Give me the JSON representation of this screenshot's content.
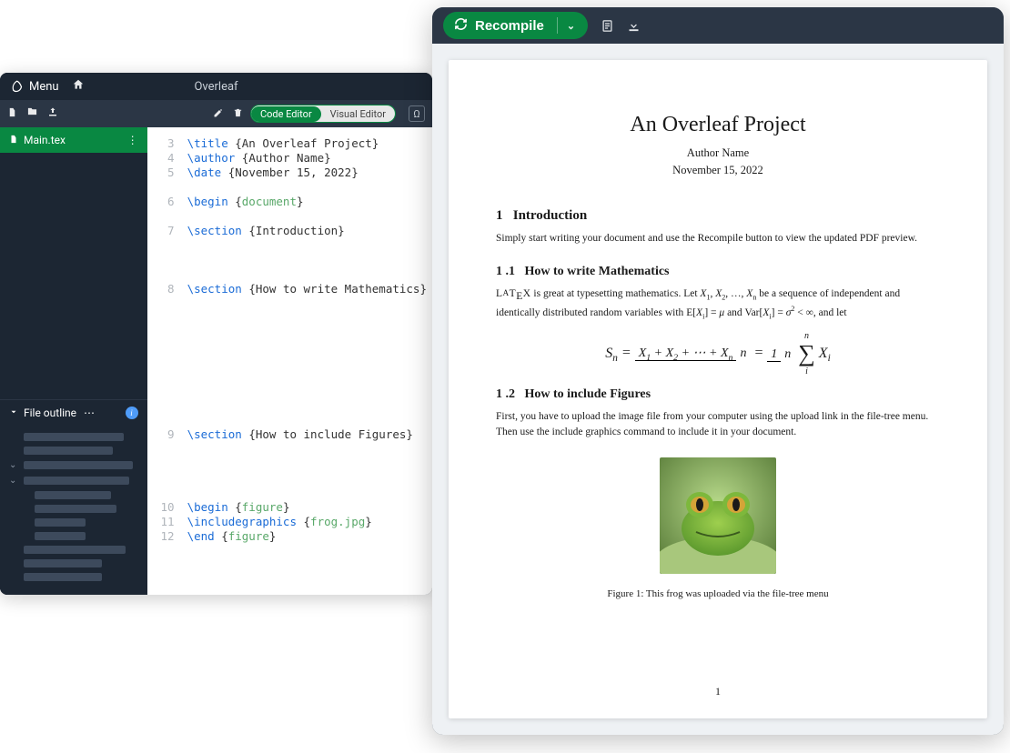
{
  "editor": {
    "menu_label": "Menu",
    "app_title": "Overleaf",
    "toggle": {
      "code": "Code Editor",
      "visual": "Visual Editor"
    },
    "file": {
      "name": "Main.tex"
    },
    "outline": {
      "title": "File outline"
    },
    "code": {
      "lines": [
        {
          "n": "3",
          "parts": [
            [
              "cmd",
              "\\title"
            ],
            [
              "txt",
              " "
            ],
            [
              "brace",
              "{"
            ],
            [
              "txt",
              "An Overleaf Project"
            ],
            [
              "brace",
              "}"
            ]
          ]
        },
        {
          "n": "4",
          "parts": [
            [
              "cmd",
              "\\author"
            ],
            [
              "txt",
              " "
            ],
            [
              "brace",
              "{"
            ],
            [
              "txt",
              "Author Name"
            ],
            [
              "brace",
              "}"
            ]
          ]
        },
        {
          "n": "5",
          "parts": [
            [
              "cmd",
              "\\date"
            ],
            [
              "txt",
              " "
            ],
            [
              "brace",
              "{"
            ],
            [
              "txt",
              "November 15, 2022"
            ],
            [
              "brace",
              "}"
            ]
          ]
        },
        {
          "n": "",
          "parts": []
        },
        {
          "n": "6",
          "parts": [
            [
              "cmd",
              "\\begin"
            ],
            [
              "txt",
              " "
            ],
            [
              "brace",
              "{"
            ],
            [
              "arg",
              "document"
            ],
            [
              "brace",
              "}"
            ]
          ]
        },
        {
          "n": "",
          "parts": []
        },
        {
          "n": "7",
          "parts": [
            [
              "cmd",
              "\\section"
            ],
            [
              "txt",
              " "
            ],
            [
              "brace",
              "{"
            ],
            [
              "txt",
              "Introduction"
            ],
            [
              "brace",
              "}"
            ]
          ]
        },
        {
          "n": "",
          "parts": []
        },
        {
          "n": "",
          "parts": []
        },
        {
          "n": "",
          "parts": []
        },
        {
          "n": "8",
          "parts": [
            [
              "cmd",
              "\\section"
            ],
            [
              "txt",
              " "
            ],
            [
              "brace",
              "{"
            ],
            [
              "txt",
              "How to write Mathematics"
            ],
            [
              "brace",
              "}"
            ]
          ]
        },
        {
          "n": "",
          "parts": []
        },
        {
          "n": "",
          "parts": []
        },
        {
          "n": "",
          "parts": []
        },
        {
          "n": "",
          "parts": []
        },
        {
          "n": "",
          "parts": []
        },
        {
          "n": "",
          "parts": []
        },
        {
          "n": "",
          "parts": []
        },
        {
          "n": "",
          "parts": []
        },
        {
          "n": "",
          "parts": []
        },
        {
          "n": "9",
          "parts": [
            [
              "cmd",
              "\\section"
            ],
            [
              "txt",
              " "
            ],
            [
              "brace",
              "{"
            ],
            [
              "txt",
              "How to include Figures"
            ],
            [
              "brace",
              "}"
            ]
          ]
        },
        {
          "n": "",
          "parts": []
        },
        {
          "n": "",
          "parts": []
        },
        {
          "n": "",
          "parts": []
        },
        {
          "n": "",
          "parts": []
        },
        {
          "n": "10",
          "parts": [
            [
              "cmd",
              "\\begin"
            ],
            [
              "txt",
              " "
            ],
            [
              "brace",
              "{"
            ],
            [
              "arg",
              "figure"
            ],
            [
              "brace",
              "}"
            ]
          ]
        },
        {
          "n": "11",
          "parts": [
            [
              "cmd",
              "\\includegraphics"
            ],
            [
              "txt",
              " "
            ],
            [
              "brace",
              "{"
            ],
            [
              "arg",
              "frog.jpg"
            ],
            [
              "brace",
              "}"
            ]
          ]
        },
        {
          "n": "12",
          "parts": [
            [
              "cmd",
              "\\end"
            ],
            [
              "txt",
              " "
            ],
            [
              "brace",
              "{"
            ],
            [
              "arg",
              "figure"
            ],
            [
              "brace",
              "}"
            ]
          ]
        }
      ]
    }
  },
  "pdf": {
    "recompile_label": "Recompile",
    "title": "An Overleaf Project",
    "author": "Author Name",
    "date": "November 15, 2022",
    "sec1_num": "1",
    "sec1_title": "Introduction",
    "sec1_body": "Simply start writing your document and use the Recompile button to view the updated PDF preview.",
    "sec11_num": "1 .1",
    "sec11_title": "How to write Mathematics",
    "sec11_body_a": " is great at typesetting mathematics. Let ",
    "sec11_body_b": " be a sequence of independent and identically distributed random variables with ",
    "sec11_body_c": " and ",
    "sec11_body_d": ", and let",
    "sec12_num": "1 .2",
    "sec12_title": "How to include Figures",
    "sec12_body": "First, you have to upload the image file from your computer using the upload link in the file-tree menu. Then use the include graphics command to include it in your document.",
    "figure_caption": "Figure 1:  This frog was uploaded via the file-tree menu",
    "page_number": "1"
  }
}
